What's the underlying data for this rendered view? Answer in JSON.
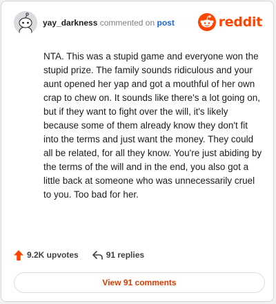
{
  "header": {
    "username": "yay_darkness",
    "action_text": "commented on",
    "target_link": "post",
    "brand": "reddit"
  },
  "comment": {
    "text": "NTA. This was a stupid game and everyone won the stupid prize. The family sounds ridiculous and your aunt opened her yap and got a mouthful of her own crap to chew on. It sounds like there's a lot going on, but if they want to fight over the will, it's likely because some of them already know they don't fit into the terms and just want the money. They could all be related, for all they know. You're just abiding by the terms of the will and in the end, you also got a little back at someone who was unnecessarily cruel to you. Too bad for her."
  },
  "stats": {
    "upvotes": "9.2K upvotes",
    "replies": "91 replies"
  },
  "footer": {
    "view_comments_label": "View 91 comments"
  },
  "icons": {
    "upvote": "upvote-arrow-icon",
    "reply": "reply-arrow-icon",
    "logo": "reddit-snoo-icon",
    "avatar": "snoo-avatar-icon"
  },
  "colors": {
    "brand": "#ff4500",
    "link": "#1a64d6",
    "button_text": "#d93a00"
  }
}
